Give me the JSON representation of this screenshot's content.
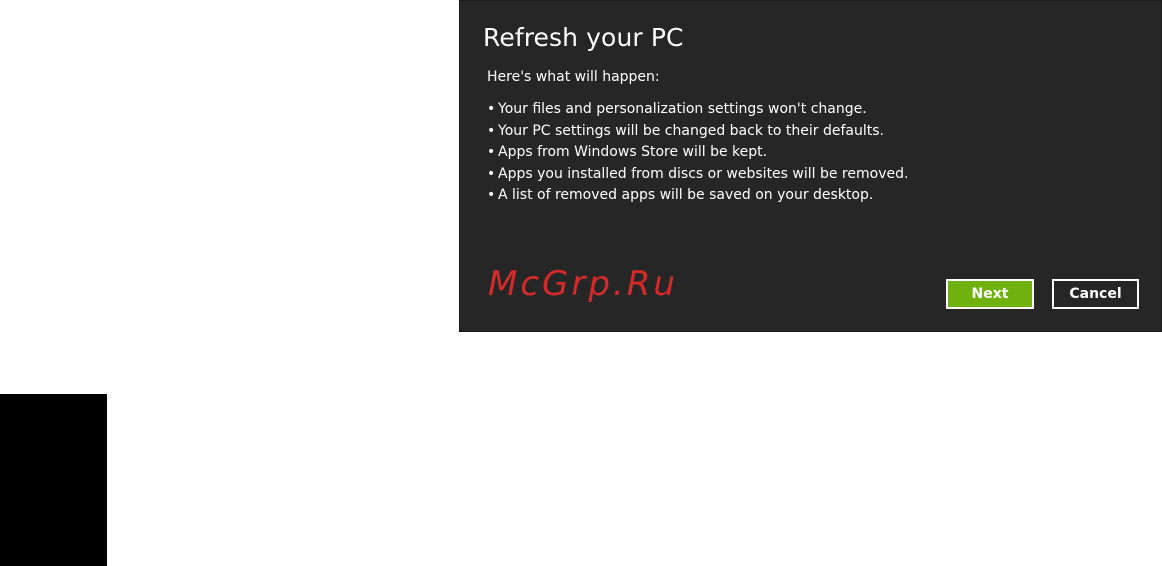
{
  "dialog": {
    "title": "Refresh your PC",
    "intro": "Here's what will happen:",
    "bullets": [
      "Your files and personalization settings won't change.",
      "Your PC settings will be changed back to their defaults.",
      "Apps from Windows Store will be kept.",
      "Apps you installed from discs or websites will be removed.",
      "A list of removed apps will be saved on your desktop."
    ],
    "bullet_glyph": "•",
    "buttons": {
      "next_label": "Next",
      "cancel_label": "Cancel"
    }
  },
  "watermark": "McGrp.Ru",
  "colors": {
    "dialog_background": "#262626",
    "next_button": "#6fb10e",
    "watermark": "#d42a2a",
    "side_block": "#000000"
  }
}
